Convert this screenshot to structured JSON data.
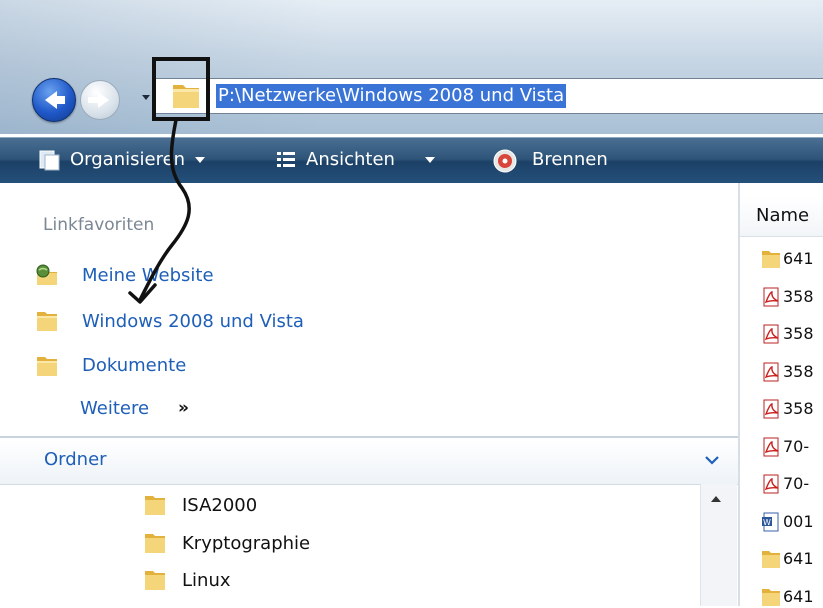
{
  "address": {
    "path": "P:\\Netzwerke\\Windows 2008 und Vista"
  },
  "toolbar": {
    "organize": "Organisieren",
    "views": "Ansichten",
    "burn": "Brennen"
  },
  "favorites": {
    "heading": "Linkfavoriten",
    "items": [
      {
        "label": "Meine Website",
        "icon": "website-icon"
      },
      {
        "label": "Windows 2008 und Vista",
        "icon": "folder-icon"
      },
      {
        "label": "Dokumente",
        "icon": "folder-icon"
      }
    ],
    "more": "Weitere",
    "more_chevron": "»"
  },
  "folders": {
    "heading": "Ordner",
    "chevron": "⌄",
    "items": [
      "ISA2000",
      "Kryptographie",
      "Linux"
    ]
  },
  "file_list": {
    "column_name": "Name",
    "rows": [
      {
        "type": "folder",
        "text": "641"
      },
      {
        "type": "pdf",
        "text": "358"
      },
      {
        "type": "pdf",
        "text": "358"
      },
      {
        "type": "pdf",
        "text": "358"
      },
      {
        "type": "pdf",
        "text": "358"
      },
      {
        "type": "pdf",
        "text": "70-"
      },
      {
        "type": "pdf",
        "text": "70-"
      },
      {
        "type": "word",
        "text": "001"
      },
      {
        "type": "folder",
        "text": "641"
      },
      {
        "type": "folder",
        "text": "641"
      }
    ]
  },
  "colors": {
    "link": "#1e5fb8",
    "selection": "#3a74d7",
    "command_bar": "#2d5378"
  }
}
